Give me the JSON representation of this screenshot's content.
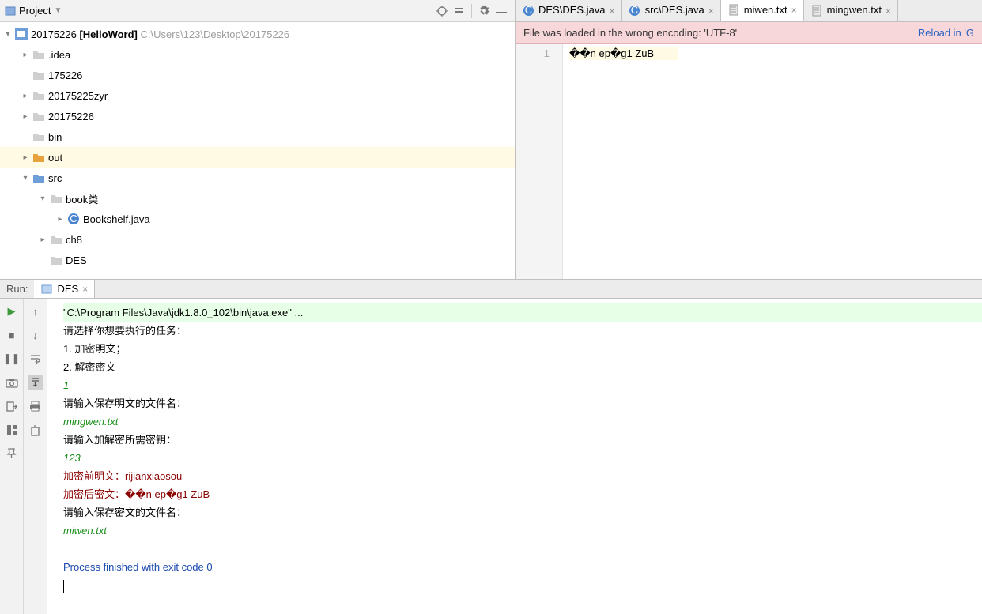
{
  "project_header": {
    "label": "Project"
  },
  "tree": {
    "root": {
      "name": "20175226",
      "project": "[HelloWord]",
      "path": "C:\\Users\\123\\Desktop\\20175226"
    },
    "nodes": [
      {
        "name": ".idea",
        "arrow": "right",
        "indent": 1,
        "type": "folder"
      },
      {
        "name": "175226",
        "arrow": "none",
        "indent": 1,
        "type": "folder"
      },
      {
        "name": "20175225zyr",
        "arrow": "right",
        "indent": 1,
        "type": "folder"
      },
      {
        "name": "20175226",
        "arrow": "right",
        "indent": 1,
        "type": "folder"
      },
      {
        "name": "bin",
        "arrow": "none",
        "indent": 1,
        "type": "folder"
      },
      {
        "name": "out",
        "arrow": "right",
        "indent": 1,
        "type": "folder-orange",
        "highlight": true
      },
      {
        "name": "src",
        "arrow": "down",
        "indent": 1,
        "type": "folder-blue"
      },
      {
        "name": "book类",
        "arrow": "down",
        "indent": 2,
        "type": "folder"
      },
      {
        "name": "Bookshelf.java",
        "arrow": "right",
        "indent": 3,
        "type": "java"
      },
      {
        "name": "ch8",
        "arrow": "right",
        "indent": 2,
        "type": "folder"
      },
      {
        "name": "DES",
        "arrow": "none",
        "indent": 2,
        "type": "folder"
      }
    ]
  },
  "tabs": [
    {
      "icon": "java",
      "label": "DES\\DES.java",
      "active": false
    },
    {
      "icon": "java",
      "label": "src\\DES.java",
      "active": false
    },
    {
      "icon": "txt",
      "label": "miwen.txt",
      "active": true
    },
    {
      "icon": "txt",
      "label": "mingwen.txt",
      "active": false
    }
  ],
  "banner": {
    "msg": "File was loaded in the wrong encoding: 'UTF-8'",
    "link": "Reload in 'G"
  },
  "editor": {
    "line_no": "1",
    "content": "��n  ep�g1   ZuB"
  },
  "run": {
    "label": "Run:",
    "tab": "DES",
    "lines": [
      {
        "cls": "cmd",
        "text": "\"C:\\Program Files\\Java\\jdk1.8.0_102\\bin\\java.exe\" ..."
      },
      {
        "cls": "",
        "text": "请选择你想要执行的任务："
      },
      {
        "cls": "",
        "text": "1. 加密明文；"
      },
      {
        "cls": "",
        "text": "2. 解密密文"
      },
      {
        "cls": "input",
        "text": "1"
      },
      {
        "cls": "",
        "text": "请输入保存明文的文件名："
      },
      {
        "cls": "input",
        "text": "mingwen.txt"
      },
      {
        "cls": "",
        "text": "请输入加解密所需密钥："
      },
      {
        "cls": "input",
        "text": "123"
      },
      {
        "cls": "out-red",
        "text": "加密前明文：rijianxiaosou"
      },
      {
        "cls": "out-red",
        "text": "加密后密文：��n  ep�g1   ZuB"
      },
      {
        "cls": "",
        "text": "请输入保存密文的文件名："
      },
      {
        "cls": "input",
        "text": "miwen.txt"
      },
      {
        "cls": "",
        "text": ""
      },
      {
        "cls": "exit",
        "text": "Process finished with exit code 0"
      }
    ]
  }
}
